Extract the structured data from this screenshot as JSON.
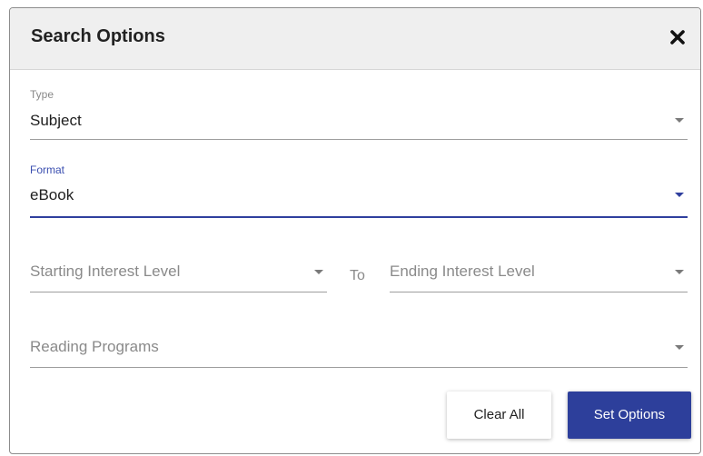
{
  "dialog": {
    "title": "Search Options",
    "close_icon": "close-icon"
  },
  "type_field": {
    "label": "Type",
    "value": "Subject"
  },
  "format_field": {
    "label": "Format",
    "value": "eBook"
  },
  "interest_level": {
    "start_placeholder": "Starting Interest Level",
    "to_label": "To",
    "end_placeholder": "Ending Interest Level"
  },
  "reading_programs": {
    "placeholder": "Reading Programs"
  },
  "buttons": {
    "clear_label": "Clear All",
    "set_label": "Set Options"
  },
  "colors": {
    "accent": "#2d3f9b",
    "header_bg": "#efefef"
  }
}
